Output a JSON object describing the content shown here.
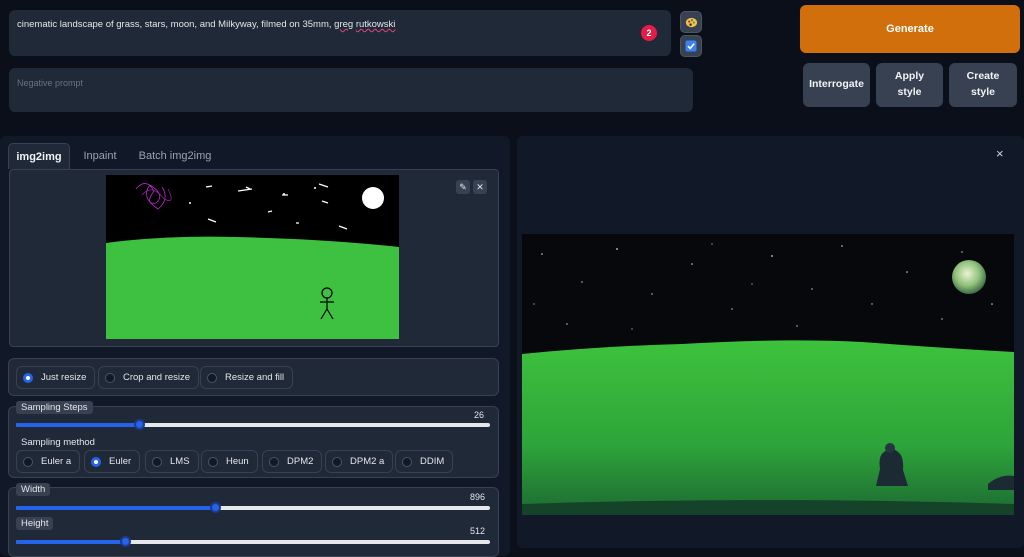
{
  "prompt": {
    "text_before": "cinematic landscape of  grass, stars, moon, and Milkyway, filmed on 35mm, ",
    "misspelled_1": "greg",
    "space": " ",
    "misspelled_2": "rutkowski",
    "token_count": "2"
  },
  "negative_prompt": {
    "placeholder": "Negative prompt"
  },
  "side_icons": {
    "top": "paint-palette-icon",
    "bottom": "checkbox-icon"
  },
  "buttons": {
    "generate": "Generate",
    "interrogate": "Interrogate",
    "apply_style_1": "Apply",
    "apply_style_2": "style",
    "create_style_1": "Create",
    "create_style_2": "style"
  },
  "tabs": [
    "img2img",
    "Inpaint",
    "Batch img2img"
  ],
  "resize_modes": {
    "options": [
      "Just resize",
      "Crop and resize",
      "Resize and fill"
    ],
    "selected": "Just resize"
  },
  "sampling_steps": {
    "label": "Sampling Steps",
    "value": "26",
    "fraction": 0.26
  },
  "sampling_method": {
    "label": "Sampling method",
    "options": [
      "Euler a",
      "Euler",
      "LMS",
      "Heun",
      "DPM2",
      "DPM2 a",
      "DDIM"
    ],
    "selected": "Euler"
  },
  "width": {
    "label": "Width",
    "value": "896",
    "fraction": 0.42
  },
  "height": {
    "label": "Height",
    "value": "512",
    "fraction": 0.23
  },
  "output": {
    "close_symbol": "×"
  },
  "colors": {
    "accent": "#2563eb",
    "generate": "#d06f0c",
    "grass": "#3ec140"
  }
}
